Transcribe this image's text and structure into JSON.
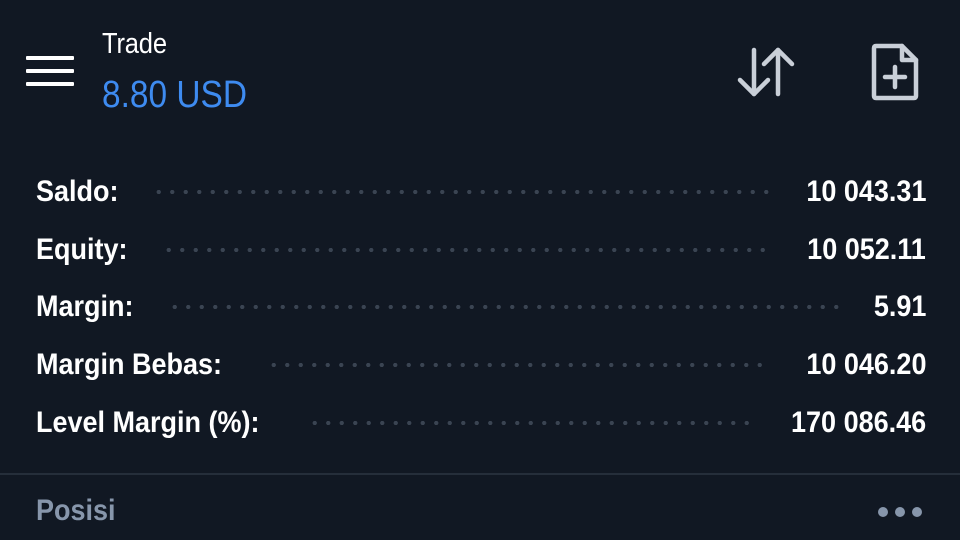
{
  "header": {
    "title": "Trade",
    "balance": "8.80 USD",
    "menu_icon": "hamburger-menu-icon",
    "sort_icon": "sort-arrows-icon",
    "new_order_icon": "new-document-plus-icon"
  },
  "account": {
    "rows": [
      {
        "label": "Saldo:",
        "value": "10 043.31"
      },
      {
        "label": "Equity:",
        "value": "10 052.11"
      },
      {
        "label": "Margin:",
        "value": "5.91"
      },
      {
        "label": "Margin Bebas:",
        "value": "10 046.20"
      },
      {
        "label": "Level Margin (%):",
        "value": "170 086.46"
      }
    ]
  },
  "positions": {
    "title": "Posisi",
    "more_icon": "more-dots-icon"
  },
  "colors": {
    "background": "#111823",
    "accent": "#3e8bf0",
    "muted": "#8796ab"
  }
}
